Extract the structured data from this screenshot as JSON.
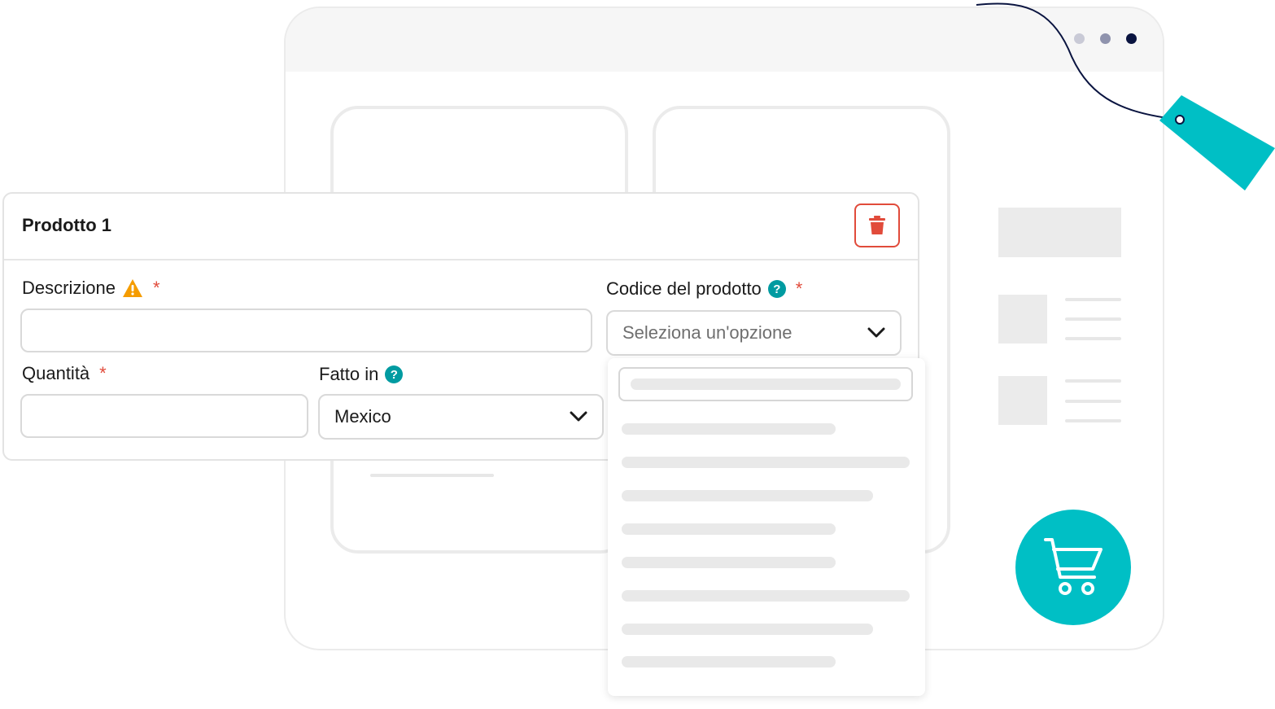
{
  "product_card": {
    "title": "Prodotto 1",
    "delete_icon": "trash-icon"
  },
  "fields": {
    "descrizione": {
      "label": "Descrizione",
      "warning_icon": "warning-icon",
      "required_mark": "*",
      "value": ""
    },
    "codice": {
      "label": "Codice del prodotto",
      "help_icon": "question-icon",
      "required_mark": "*",
      "placeholder": "Seleziona un'opzione"
    },
    "quantita": {
      "label": "Quantità",
      "required_mark": "*",
      "value": ""
    },
    "fatto_in": {
      "label": "Fatto in",
      "help_icon": "question-icon",
      "selected": "Mexico"
    }
  },
  "colors": {
    "accent": "#00bfc5",
    "help": "#009ba1",
    "danger": "#e14b3b",
    "warning": "#f59c00"
  },
  "icons": [
    "trash-icon",
    "warning-icon",
    "question-icon",
    "chevron-down-icon",
    "cart-icon",
    "price-tag-icon"
  ]
}
